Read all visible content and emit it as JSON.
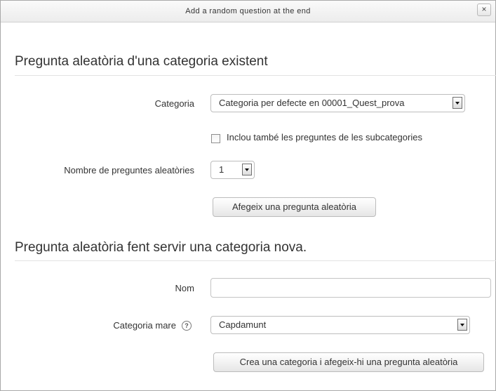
{
  "dialog": {
    "title": "Add a random question at the end",
    "close_glyph": "×"
  },
  "existing_category": {
    "heading": "Pregunta aleatòria d'una categoria existent",
    "category_label": "Categoria",
    "category_value": "Categoria per defecte en 00001_Quest_prova",
    "include_subcategories_label": "Inclou també les preguntes de les subcategories",
    "include_subcategories_checked": false,
    "count_label": "Nombre de preguntes aleatòries",
    "count_value": "1",
    "add_button": "Afegeix una pregunta aleatòria"
  },
  "new_category": {
    "heading": "Pregunta aleatòria fent servir una categoria nova.",
    "name_label": "Nom",
    "name_value": "",
    "parent_label": "Categoria mare",
    "help_glyph": "?",
    "parent_value": "Capdamunt",
    "create_button": "Crea una categoria i afegeix-hi una pregunta aleatòria"
  }
}
